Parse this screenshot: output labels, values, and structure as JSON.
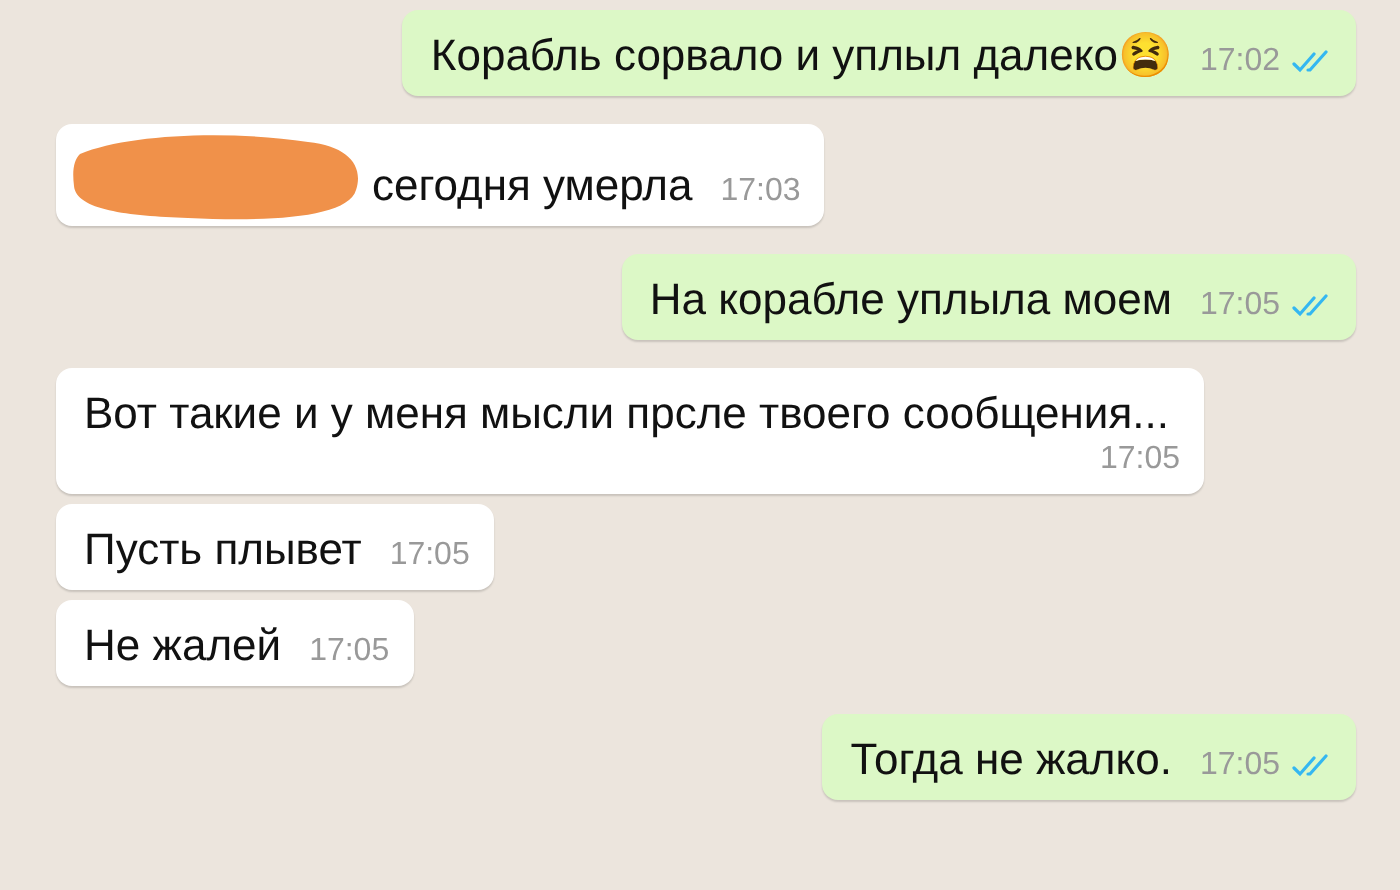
{
  "messages": [
    {
      "kind": "outgoing",
      "text": "Корабль сорвало и уплыл далеко😫",
      "time": "17:02",
      "read": true
    },
    {
      "kind": "incoming",
      "redacted": true,
      "text": "сегодня умерла",
      "time": "17:03"
    },
    {
      "kind": "outgoing",
      "text": "На корабле уплыла моем",
      "time": "17:05",
      "read": true
    },
    {
      "kind": "incoming",
      "text": "Вот такие и у меня мысли прсле твоего сообщения...",
      "time": "17:05"
    },
    {
      "kind": "incoming",
      "text": "Пусть плывет",
      "time": "17:05"
    },
    {
      "kind": "incoming",
      "text": "Не жалей",
      "time": "17:05"
    },
    {
      "kind": "outgoing",
      "text": "Тогда не жалко.",
      "time": "17:05",
      "read": true
    }
  ]
}
